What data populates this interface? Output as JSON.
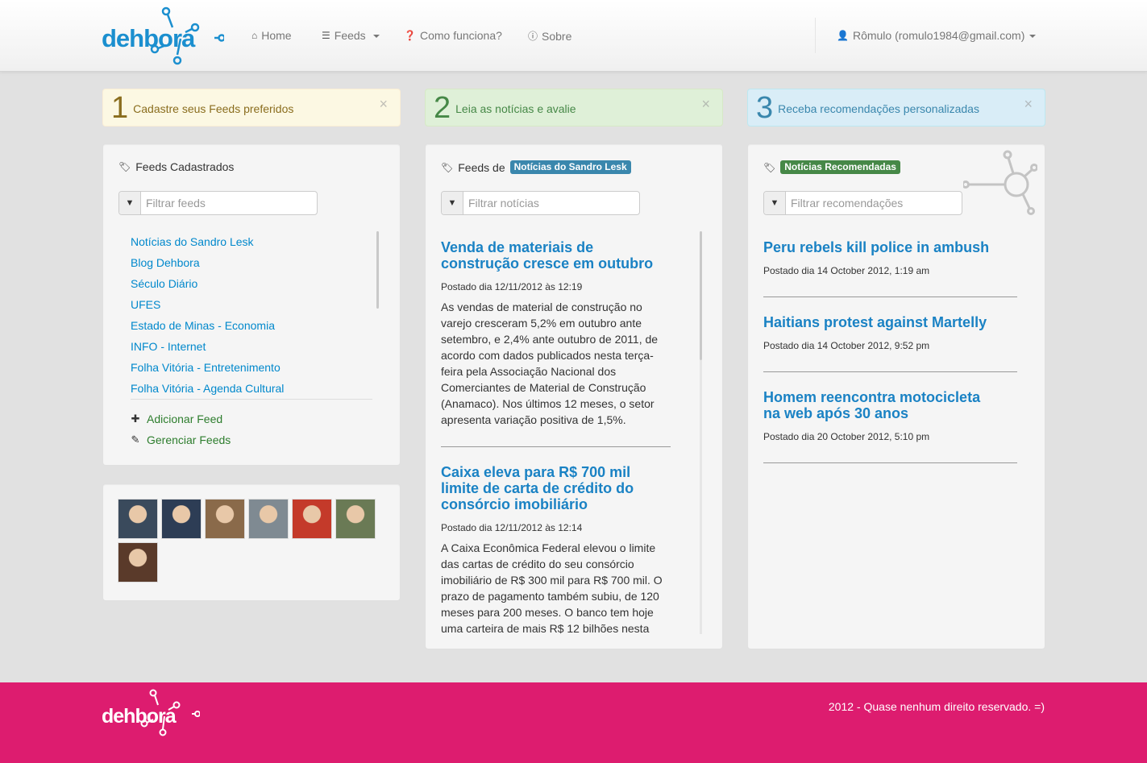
{
  "brand": {
    "name": "dehbora",
    "primary_color": "#1b8fcf",
    "footer_color": "#dd1c6f"
  },
  "nav": {
    "home": "Home",
    "feeds": "Feeds",
    "how_it_works": "Como funciona?",
    "about": "Sobre",
    "user": "Rômulo (romulo1984@gmail.com)"
  },
  "steps": [
    {
      "num": "1",
      "text": "Cadastre seus Feeds preferidos",
      "close": "×"
    },
    {
      "num": "2",
      "text": "Leia as notícias e avalie",
      "close": "×"
    },
    {
      "num": "3",
      "text": "Receba recomendações personalizadas",
      "close": "×"
    }
  ],
  "feeds_panel": {
    "title": "Feeds Cadastrados",
    "filter_placeholder": "Filtrar feeds",
    "items": [
      "Notícias do Sandro Lesk",
      "Blog Dehbora",
      "Século Diário",
      "UFES",
      "Estado de Minas - Economia",
      "INFO - Internet",
      "Folha Vitória - Entretenimento",
      "Folha Vitória - Agenda Cultural"
    ],
    "add_label": "Adicionar Feed",
    "manage_label": "Gerenciar Feeds"
  },
  "news_panel": {
    "title_prefix": "Feeds de",
    "feed_label": "Notícias do Sandro Lesk",
    "filter_placeholder": "Filtrar notícias",
    "items": [
      {
        "title": "Venda de materiais de construção cresce em outubro",
        "date": "Postado dia 12/11/2012 às 12:19",
        "body": "As vendas de material de construção no varejo cresceram 5,2% em outubro ante setembro, e 2,4% ante outubro de 2011, de acordo com dados publicados nesta terça-feira pela Associação Nacional dos Comerciantes de Material de Construção (Anamaco). Nos últimos 12 meses, o setor apresenta variação positiva de 1,5%."
      },
      {
        "title": "Caixa eleva para R$ 700 mil limite de carta de crédito do consórcio imobiliário",
        "date": "Postado dia 12/11/2012 às 12:14",
        "body": "A Caixa Econômica Federal elevou o limite das cartas de crédito do seu consórcio imobiliário de R$ 300 mil para R$ 700 mil. O prazo de pagamento também subiu, de 120 meses para 200 meses. O banco tem hoje uma carteira de mais R$ 12 bilhões nesta"
      }
    ]
  },
  "rec_panel": {
    "label": "Notícias Recomendadas",
    "filter_placeholder": "Filtrar recomendações",
    "items": [
      {
        "title": "Peru rebels kill police in ambush",
        "date": "Postado dia 14 October 2012, 1:19 am"
      },
      {
        "title": "Haitians protest against Martelly",
        "date": "Postado dia 14 October 2012, 9:52 pm"
      },
      {
        "title": "Homem reencontra motocicleta na web após 30 anos",
        "date": "Postado dia 20 October 2012, 5:10 pm"
      }
    ]
  },
  "friends": {
    "avatars": [
      {
        "name": "avatar-1",
        "color": "#3a4a5c"
      },
      {
        "name": "avatar-2",
        "color": "#2d3d55"
      },
      {
        "name": "avatar-3",
        "color": "#8a6a4a"
      },
      {
        "name": "avatar-4",
        "color": "#7f8a92"
      },
      {
        "name": "avatar-5",
        "color": "#c43a2a"
      },
      {
        "name": "avatar-6",
        "color": "#6a7a55"
      },
      {
        "name": "avatar-7",
        "color": "#5a3a2a"
      }
    ]
  },
  "footer": {
    "text": "2012 - Quase nenhum direito reservado. =)"
  }
}
